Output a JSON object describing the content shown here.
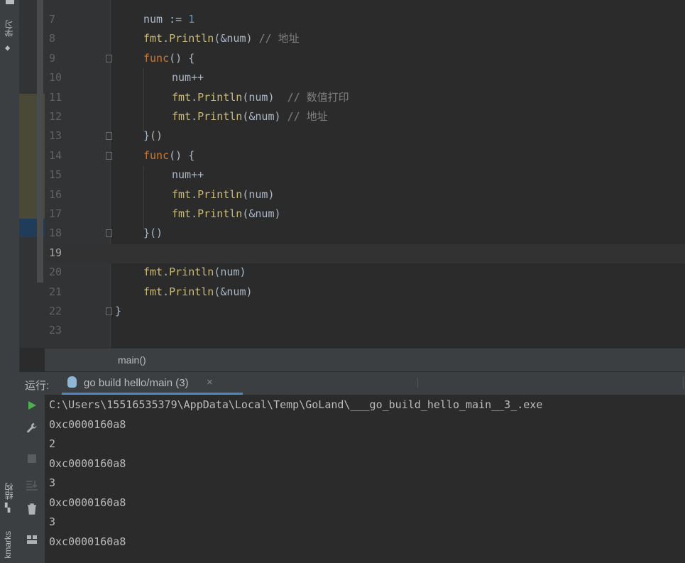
{
  "left_sidebar": {
    "tab_study": "学习",
    "tab_structure": "结构",
    "tab_bookmarks": "kmarks"
  },
  "editor": {
    "lines": [
      {
        "number": "7",
        "tokens": [
          {
            "t": "num := ",
            "c": "plain"
          },
          {
            "t": "1",
            "c": "num"
          }
        ]
      },
      {
        "number": "8",
        "tokens": [
          {
            "t": "fmt",
            "c": "pk"
          },
          {
            "t": ".",
            "c": "plain"
          },
          {
            "t": "Println",
            "c": "pk"
          },
          {
            "t": "(&num) ",
            "c": "plain"
          },
          {
            "t": "// 地址",
            "c": "cm"
          }
        ]
      },
      {
        "number": "9",
        "tokens": [
          {
            "t": "func",
            "c": "kw"
          },
          {
            "t": "() {",
            "c": "plain"
          }
        ]
      },
      {
        "number": "10",
        "tokens": [
          {
            "t": "num++",
            "c": "plain"
          }
        ]
      },
      {
        "number": "11",
        "tokens": [
          {
            "t": "fmt",
            "c": "pk"
          },
          {
            "t": ".",
            "c": "plain"
          },
          {
            "t": "Println",
            "c": "pk"
          },
          {
            "t": "(num)  ",
            "c": "plain"
          },
          {
            "t": "// 数值打印",
            "c": "cm"
          }
        ]
      },
      {
        "number": "12",
        "tokens": [
          {
            "t": "fmt",
            "c": "pk"
          },
          {
            "t": ".",
            "c": "plain"
          },
          {
            "t": "Println",
            "c": "pk"
          },
          {
            "t": "(&num) ",
            "c": "plain"
          },
          {
            "t": "// 地址",
            "c": "cm"
          }
        ]
      },
      {
        "number": "13",
        "tokens": [
          {
            "t": "}()",
            "c": "plain"
          }
        ]
      },
      {
        "number": "14",
        "tokens": [
          {
            "t": "func",
            "c": "kw"
          },
          {
            "t": "() {",
            "c": "plain"
          }
        ]
      },
      {
        "number": "15",
        "tokens": [
          {
            "t": "num++",
            "c": "plain"
          }
        ]
      },
      {
        "number": "16",
        "tokens": [
          {
            "t": "fmt",
            "c": "pk"
          },
          {
            "t": ".",
            "c": "plain"
          },
          {
            "t": "Println",
            "c": "pk"
          },
          {
            "t": "(num)",
            "c": "plain"
          }
        ]
      },
      {
        "number": "17",
        "tokens": [
          {
            "t": "fmt",
            "c": "pk"
          },
          {
            "t": ".",
            "c": "plain"
          },
          {
            "t": "Println",
            "c": "pk"
          },
          {
            "t": "(&num)",
            "c": "plain"
          }
        ]
      },
      {
        "number": "18",
        "tokens": [
          {
            "t": "}()",
            "c": "plain"
          }
        ]
      },
      {
        "number": "19",
        "tokens": []
      },
      {
        "number": "20",
        "tokens": [
          {
            "t": "fmt",
            "c": "pk"
          },
          {
            "t": ".",
            "c": "plain"
          },
          {
            "t": "Println",
            "c": "pk"
          },
          {
            "t": "(num)",
            "c": "plain"
          }
        ]
      },
      {
        "number": "21",
        "tokens": [
          {
            "t": "fmt",
            "c": "pk"
          },
          {
            "t": ".",
            "c": "plain"
          },
          {
            "t": "Println",
            "c": "pk"
          },
          {
            "t": "(&num)",
            "c": "plain"
          }
        ]
      },
      {
        "number": "22",
        "tokens": [
          {
            "t": "}",
            "c": "plain"
          }
        ]
      },
      {
        "number": "23",
        "tokens": []
      }
    ],
    "active_line": "19"
  },
  "breadcrumb": "main()",
  "run_panel": {
    "label": "运行:",
    "tab_title": "go build hello/main (3)",
    "close_symbol": "×",
    "output": [
      "C:\\Users\\15516535379\\AppData\\Local\\Temp\\GoLand\\___go_build_hello_main__3_.exe",
      "0xc0000160a8",
      "2",
      "0xc0000160a8",
      "3",
      "0xc0000160a8",
      "3",
      "0xc0000160a8"
    ]
  },
  "colors": {
    "keyword": "#cc7832",
    "package_call": "#c8ba79",
    "number": "#6897bb",
    "comment": "#808080",
    "run_accent": "#4a88c7",
    "run_play": "#4caf50"
  },
  "icons": [
    "run-icon",
    "wrench-icon",
    "stop-icon",
    "scroll-to-end-icon",
    "trash-icon",
    "layout-icon",
    "gopher-icon",
    "close-icon"
  ]
}
